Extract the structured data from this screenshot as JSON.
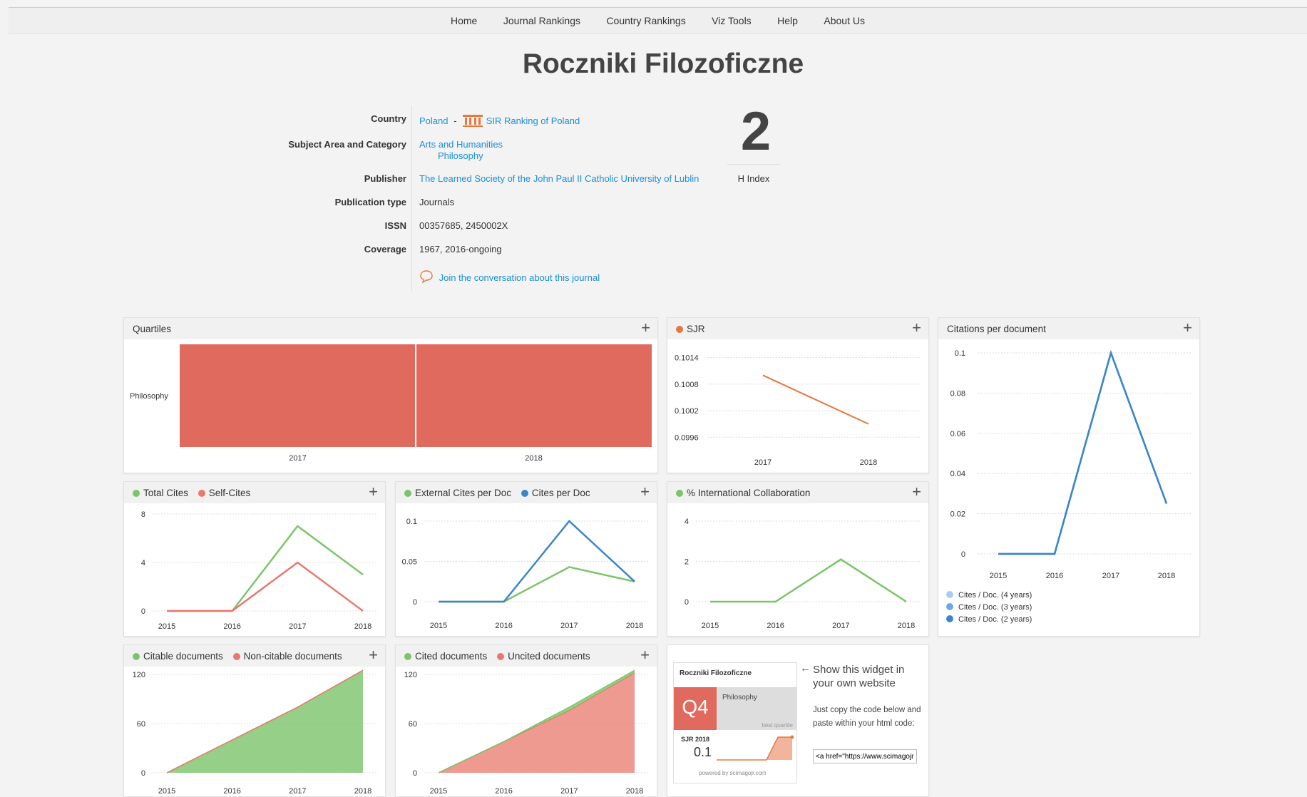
{
  "nav": {
    "items": [
      "Home",
      "Journal Rankings",
      "Country Rankings",
      "Viz Tools",
      "Help",
      "About Us"
    ]
  },
  "journal": {
    "title": "Roczniki Filozoficzne",
    "labels": {
      "country": "Country",
      "subject": "Subject Area and Category",
      "publisher": "Publisher",
      "pubtype": "Publication type",
      "issn": "ISSN",
      "coverage": "Coverage"
    },
    "country": "Poland",
    "country_sep": "-",
    "sir_link": "SIR Ranking of Poland",
    "subject_area": "Arts and Humanities",
    "subject_category": "Philosophy",
    "publisher": "The Learned Society of the John Paul II Catholic University of Lublin",
    "publication_type": "Journals",
    "issn": "00357685, 2450002X",
    "coverage": "1967, 2016-ongoing",
    "conversation_link": "Join the conversation about this journal",
    "h_index_value": "2",
    "h_index_label": "H Index"
  },
  "colors": {
    "green": "#7cc46a",
    "red": "#e8786c",
    "blue": "#3b86c8",
    "orange": "#e8773f",
    "quartile_q4": "#e06a5e",
    "light_blue": "#a9cdee",
    "mid_blue": "#6aaae0"
  },
  "panels": {
    "quartiles": {
      "title": "Quartiles",
      "plus": "+"
    },
    "sjr": {
      "title": "SJR",
      "plus": "+"
    },
    "cpd": {
      "title": "Citations per document",
      "plus": "+"
    },
    "cites": {
      "legend": [
        "Total Cites",
        "Self-Cites"
      ],
      "plus": "+"
    },
    "ext": {
      "legend": [
        "External Cites per Doc",
        "Cites per Doc"
      ],
      "plus": "+"
    },
    "intl": {
      "title": "% International Collaboration",
      "plus": "+"
    },
    "citable": {
      "legend": [
        "Citable documents",
        "Non-citable documents"
      ],
      "plus": "+"
    },
    "cited": {
      "legend": [
        "Cited documents",
        "Uncited documents"
      ],
      "plus": "+"
    }
  },
  "chart_data": [
    {
      "id": "quartiles",
      "type": "heatmap",
      "categories": [
        "2017",
        "2018"
      ],
      "rows": [
        "Philosophy"
      ],
      "values": [
        [
          "Q4",
          "Q4"
        ]
      ]
    },
    {
      "id": "sjr",
      "type": "line",
      "x": [
        "2017",
        "2018"
      ],
      "yticks": [
        "0.1014",
        "0.1008",
        "0.1002",
        "0.0996"
      ],
      "series": [
        {
          "name": "SJR",
          "values": [
            0.101,
            0.0999
          ]
        }
      ],
      "ylim": [
        0.0993,
        0.1017
      ]
    },
    {
      "id": "cpd",
      "type": "line",
      "x": [
        "2015",
        "2016",
        "2017",
        "2018"
      ],
      "yticks": [
        "0.1",
        "0.08",
        "0.06",
        "0.04",
        "0.02",
        "0"
      ],
      "ylim": [
        0,
        0.1
      ],
      "series": [
        {
          "name": "Cites / Doc. (4 years)",
          "values": [
            0,
            0,
            0.1,
            0.025
          ]
        },
        {
          "name": "Cites / Doc. (3 years)",
          "values": [
            0,
            0,
            0.1,
            0.025
          ]
        },
        {
          "name": "Cites / Doc. (2 years)",
          "values": [
            0,
            0,
            0.1,
            0.025
          ]
        }
      ]
    },
    {
      "id": "cites",
      "type": "line",
      "x": [
        "2015",
        "2016",
        "2017",
        "2018"
      ],
      "yticks": [
        "8",
        "4",
        "0"
      ],
      "ylim": [
        0,
        8
      ],
      "series": [
        {
          "name": "Total Cites",
          "values": [
            0,
            0,
            7,
            3
          ]
        },
        {
          "name": "Self-Cites",
          "values": [
            0,
            0,
            4,
            0
          ]
        }
      ]
    },
    {
      "id": "ext",
      "type": "line",
      "x": [
        "2015",
        "2016",
        "2017",
        "2018"
      ],
      "yticks": [
        "0.1",
        "0.05",
        "0"
      ],
      "ylim": [
        0,
        0.1
      ],
      "series": [
        {
          "name": "External Cites per Doc",
          "values": [
            0,
            0,
            0.043,
            0.025
          ]
        },
        {
          "name": "Cites per Doc",
          "values": [
            0,
            0,
            0.1,
            0.025
          ]
        }
      ]
    },
    {
      "id": "intl",
      "type": "line",
      "x": [
        "2015",
        "2016",
        "2017",
        "2018"
      ],
      "yticks": [
        "4",
        "2",
        "0"
      ],
      "ylim": [
        0,
        4
      ],
      "series": [
        {
          "name": "% International Collaboration",
          "values": [
            0,
            0,
            2.1,
            0
          ]
        }
      ]
    },
    {
      "id": "citable",
      "type": "area",
      "x": [
        "2015",
        "2016",
        "2017",
        "2018"
      ],
      "yticks": [
        "120",
        "60",
        "0"
      ],
      "ylim": [
        0,
        120
      ],
      "series": [
        {
          "name": "Citable documents",
          "values": [
            0,
            40,
            80,
            125
          ]
        },
        {
          "name": "Non-citable documents",
          "values": [
            0,
            0,
            0,
            0
          ]
        }
      ]
    },
    {
      "id": "cited",
      "type": "area",
      "x": [
        "2015",
        "2016",
        "2017",
        "2018"
      ],
      "yticks": [
        "120",
        "60",
        "0"
      ],
      "ylim": [
        0,
        120
      ],
      "series": [
        {
          "name": "Cited documents",
          "values": [
            0,
            0,
            4,
            3
          ]
        },
        {
          "name": "Uncited documents",
          "values": [
            0,
            38,
            76,
            122
          ]
        }
      ]
    }
  ],
  "widget": {
    "title": "Roczniki Filozoficzne",
    "quartile": "Q4",
    "category": "Philosophy",
    "best_quartile": "best quartile",
    "sjr_label": "SJR 2018",
    "sjr_value": "0.1",
    "powered_by": "powered by scimagojr.com",
    "arrow": "←",
    "show_text": "Show this widget in your own website",
    "instructions": "Just copy the code below and paste within your html code:",
    "code_value": "<a href=\"https://www.scimagojr.com"
  }
}
